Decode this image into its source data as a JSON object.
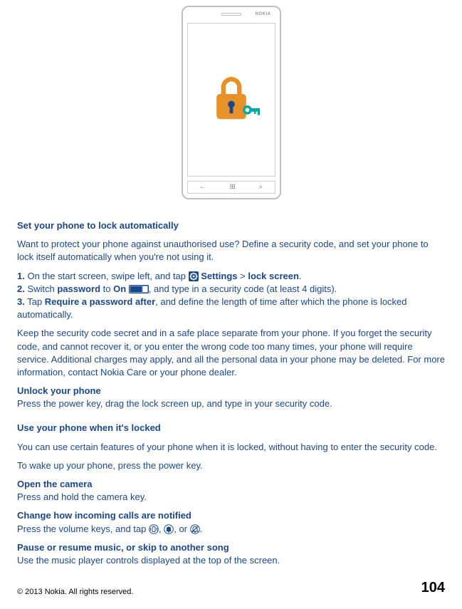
{
  "phone": {
    "brand": "NOKIA",
    "nav_back": "←",
    "nav_win": "⊞",
    "nav_search": "⌕"
  },
  "sec1": {
    "heading": "Set your phone to lock automatically",
    "intro": "Want to protect your phone against unauthorised use? Define a security code, and set your phone to lock itself automatically when you're not using it.",
    "step1_num": "1.",
    "step1_a": " On the start screen, swipe left, and tap ",
    "step1_b": " Settings",
    "step1_c": " > ",
    "step1_d": "lock screen",
    "step1_e": ".",
    "step2_num": "2.",
    "step2_a": " Switch ",
    "step2_b": "password",
    "step2_c": " to ",
    "step2_d": "On",
    "step2_e": " ",
    "step2_f": ", and type in a security code (at least 4 digits).",
    "step3_num": "3.",
    "step3_a": " Tap ",
    "step3_b": "Require a password after",
    "step3_c": ", and define the length of time after which the phone is locked automatically.",
    "warn": "Keep the security code secret and in a safe place separate from your phone. If you forget the security code, and cannot recover it, or you enter the wrong code too many times, your phone will require service. Additional charges may apply, and all the personal data in your phone may be deleted. For more information, contact Nokia Care or your phone dealer.",
    "unlock_h": "Unlock your phone",
    "unlock_t": "Press the power key, drag the lock screen up, and type in your security code."
  },
  "sec2": {
    "heading": "Use your phone when it's locked",
    "intro": "You can use certain features of your phone when it is locked, without having to enter the security code.",
    "wake": "To wake up your phone, press the power key.",
    "cam_h": "Open the camera",
    "cam_t": "Press and hold the camera key.",
    "calls_h": "Change how incoming calls are notified",
    "calls_a": "Press the volume keys, and tap ",
    "calls_comma1": ", ",
    "calls_comma2": ", or ",
    "calls_end": ".",
    "music_h": "Pause or resume music, or skip to another song",
    "music_t": "Use the music player controls displayed at the top of the screen."
  },
  "footer": {
    "copyright": "© 2013 Nokia. All rights reserved.",
    "page": "104"
  }
}
